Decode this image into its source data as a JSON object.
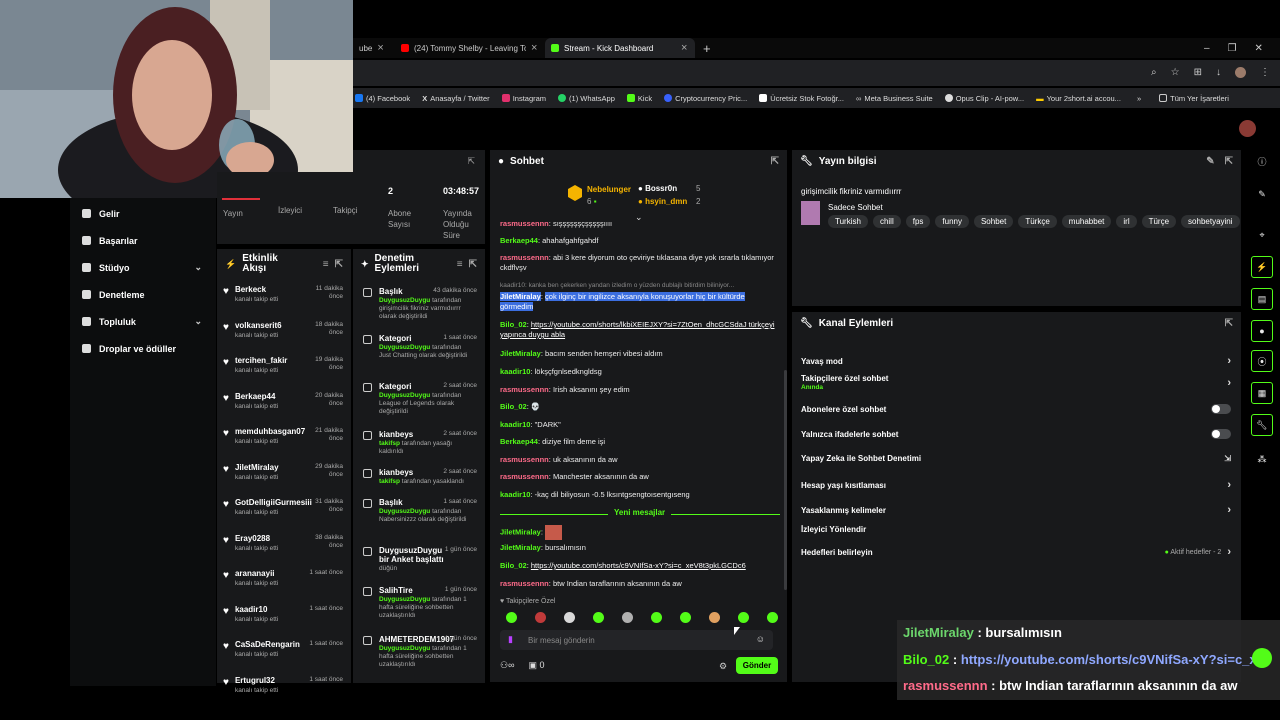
{
  "tabs": [
    {
      "label": "ube"
    },
    {
      "label": "(24) Tommy Shelby - Leaving To"
    },
    {
      "label": "Stream - Kick Dashboard"
    }
  ],
  "bookmarks": [
    "(4) Facebook",
    "Anasayfa / Twitter",
    "Instagram",
    "(1) WhatsApp",
    "Kick",
    "Cryptocurrency Pric...",
    "Ücretsiz Stok Fotoğr...",
    "Meta Business Suite",
    "Opus Clip - AI-pow...",
    "Your 2short.ai accou...",
    "Tüm Yer İşaretleri"
  ],
  "sidebar": {
    "items": [
      {
        "label": "Gelir"
      },
      {
        "label": "Başarılar"
      },
      {
        "label": "Stüdyo"
      },
      {
        "label": "Denetleme"
      },
      {
        "label": "Topluluk"
      },
      {
        "label": "Droplar ve ödüller"
      }
    ]
  },
  "stats": {
    "tab1": "Yayın",
    "tab2": "İzleyici",
    "tab3": "Takipçi",
    "subs_value": "2",
    "subs_label": "Abone Sayısı",
    "duration_value": "03:48:57",
    "duration_label": "Yayında Olduğu Süre"
  },
  "activity": {
    "title": "Etkinlik Akışı",
    "subtitle": "kanalı takip etti",
    "items": [
      {
        "name": "Berkeck",
        "time": "11 dakika önce"
      },
      {
        "name": "volkanserit6",
        "time": "18 dakika önce"
      },
      {
        "name": "tercihen_fakir",
        "time": "19 dakika önce"
      },
      {
        "name": "Berkaep44",
        "time": "20 dakika önce"
      },
      {
        "name": "memduhbasgan07",
        "time": "21 dakika önce"
      },
      {
        "name": "JiletMiralay",
        "time": "29 dakika önce"
      },
      {
        "name": "GotDelligiiGurmesiii",
        "time": "31 dakika önce"
      },
      {
        "name": "Eray0288",
        "time": "38 dakika önce"
      },
      {
        "name": "arananayii",
        "time": "1 saat önce"
      },
      {
        "name": "kaadir10",
        "time": "1 saat önce"
      },
      {
        "name": "CaSaDeRengarin",
        "time": "1 saat önce"
      },
      {
        "name": "Ertugrul32",
        "time": "1 saat önce"
      }
    ]
  },
  "moderation": {
    "title": "Denetim Eylemleri",
    "items": [
      {
        "title": "Başlık",
        "time": "43 dakika önce",
        "actor": "DuygusuzDuygu",
        "desc": "tarafından girişimcilik fikriniz varmıdıırrr olarak değiştirildi"
      },
      {
        "title": "Kategori",
        "time": "1 saat önce",
        "actor": "DuygusuzDuygu",
        "desc": "tarafından Just Chatting olarak değiştirildi"
      },
      {
        "title": "Kategori",
        "time": "2 saat önce",
        "actor": "DuygusuzDuygu",
        "desc": "tarafından League of Legends olarak değiştirildi"
      },
      {
        "title": "kianbeys",
        "time": "2 saat önce",
        "actor": "takifsp",
        "desc": "tarafından yasağı kaldırıldı"
      },
      {
        "title": "kianbeys",
        "time": "2 saat önce",
        "actor": "takifsp",
        "desc": "tarafından yasaklandı"
      },
      {
        "title": "Başlık",
        "time": "1 saat önce",
        "actor": "DuygusuzDuygu",
        "desc": "tarafından Nabersinizzz olarak değiştirildi"
      },
      {
        "title": "DuygusuzDuygu bir Anket başlattı",
        "time": "1 gün önce",
        "actor": "",
        "desc": "düğün"
      },
      {
        "title": "SalihTire",
        "time": "1 gün önce",
        "actor": "DuygusuzDuygu",
        "desc": "tarafından 1 hafta süreliğine sohbetten uzaklaştırıldı"
      },
      {
        "title": "AHMETERDEM1907",
        "time": "1 gün önce",
        "actor": "DuygusuzDuygu",
        "desc": "tarafından 1 hafta süreliğine sohbetten uzaklaştırıldı"
      }
    ]
  },
  "chat": {
    "title": "Sohbet",
    "pinned": [
      {
        "name": "Nebelunger",
        "count": "6"
      },
      {
        "name": "Bossr0n",
        "count": "5"
      },
      {
        "name": "hsyin_dmn",
        "count": "2"
      }
    ],
    "messages": [
      {
        "user": "rasmussennn",
        "color": "r",
        "text": "sışşşşşşçşşşşşıııı"
      },
      {
        "user": "Berkaep44",
        "color": "g",
        "text": "ahahafgahfgahdf"
      },
      {
        "user": "rasmussennn",
        "color": "r",
        "text": "abi 3 kere diyorum oto çeviriye tıklasana diye yok ısrarla tıklamıyor ckdflvşv"
      },
      {
        "user": "kaadir10",
        "color": "x",
        "text": "kanka ben çekerken yandan izledim o yüzden dublajlı bitirdim biliniyor..."
      },
      {
        "user": "JiletMiralay",
        "color": "hl",
        "text": "çok ilginç bir ingilizce aksanıyla konuşuyorlar hiç bir kültürde görmedim"
      },
      {
        "user": "Bilo_02",
        "color": "g",
        "text": "https://youtube.com/shorts/lkbiXEIEJXY?si=7ZtOen_dhcGCSdaJ türkçeyi yapınca duygu abla"
      },
      {
        "user": "JiletMiralay",
        "color": "g",
        "text": "bacım senden hemşeri vibesi aldım"
      },
      {
        "user": "kaadir10",
        "color": "g",
        "text": "lökşçfgnlsedkngldsg"
      },
      {
        "user": "rasmussennn",
        "color": "r",
        "text": "Irish aksanını şey edim"
      },
      {
        "user": "Bilo_02",
        "color": "g",
        "text": "💀"
      },
      {
        "user": "kaadir10",
        "color": "g",
        "text": "\"DARK\""
      },
      {
        "user": "Berkaep44",
        "color": "g",
        "text": "diziye film deme işi"
      },
      {
        "user": "rasmussennn",
        "color": "r",
        "text": "uk aksanının da aw"
      },
      {
        "user": "rasmussennn",
        "color": "r",
        "text": "Manchester aksanının da aw"
      },
      {
        "user": "kaadir10",
        "color": "g",
        "text": "-kaç dil biliyosun -0.5 lksıntgsengtoısentgıseng"
      }
    ],
    "new_messages_label": "Yeni mesajlar",
    "new_messages": [
      {
        "user": "JiletMiralay",
        "color": "g",
        "text": ""
      },
      {
        "user": "JiletMiralay",
        "color": "g",
        "text": "bursalımısın"
      },
      {
        "user": "Bilo_02",
        "color": "g",
        "text": "https://youtube.com/shorts/c9VNIfSa-xY?si=c_xeV8t3pkLGCDc6"
      },
      {
        "user": "rasmussennn",
        "color": "r",
        "text": "btw Indian taraflarının aksanının da aw"
      }
    ],
    "followers_only": "Takipçilere Özel",
    "input_placeholder": "Bir mesaj gönderin",
    "footer_count": "0",
    "send_label": "Gönder"
  },
  "info": {
    "title": "Yayın bilgisi",
    "stream_title": "girişimcilik fikriniz varmıdıırrr",
    "category": "Sadece Sohbet",
    "tags": [
      "Turkish",
      "chill",
      "fps",
      "funny",
      "Sohbet",
      "Türkçe",
      "muhabbet",
      "irl",
      "Türçe",
      "sohbetyayini"
    ]
  },
  "channel": {
    "title": "Kanal Eylemleri",
    "rows": [
      {
        "label": "Yavaş mod",
        "kind": "chev",
        "sub": ""
      },
      {
        "label": "Takipçilere özel sohbet",
        "kind": "chev",
        "sub": "Anında"
      },
      {
        "label": "Abonelere özel sohbet",
        "kind": "toggle",
        "sub": ""
      },
      {
        "label": "Yalnızca ifadelerle sohbet",
        "kind": "toggle",
        "sub": ""
      },
      {
        "label": "Yapay Zeka ile Sohbet Denetimi",
        "kind": "ext",
        "sub": ""
      },
      {
        "label": "Hesap yaşı kısıtlaması",
        "kind": "chev",
        "sub": ""
      },
      {
        "label": "Yasaklanmış kelimeler",
        "kind": "chev",
        "sub": ""
      },
      {
        "label": "İzleyici Yönlendir",
        "kind": "none",
        "sub": ""
      },
      {
        "label": "Hedefleri belirleyin",
        "kind": "goal",
        "sub": "Aktif hedefler - 2"
      }
    ]
  },
  "overlay": [
    {
      "user": "JiletMiralay",
      "text": "bursalımısın"
    },
    {
      "user": "Bilo_02",
      "text": "https://youtube.com/shorts/c9VNifSa-xY?si=c_x"
    },
    {
      "user": "rasmussennn",
      "text": "btw Indian taraflarının aksanının da aw"
    }
  ],
  "colors": {
    "accent": "#53fc18",
    "panel": "#18191b",
    "bg": "#000000",
    "rasmus": "#ff6b8a"
  }
}
